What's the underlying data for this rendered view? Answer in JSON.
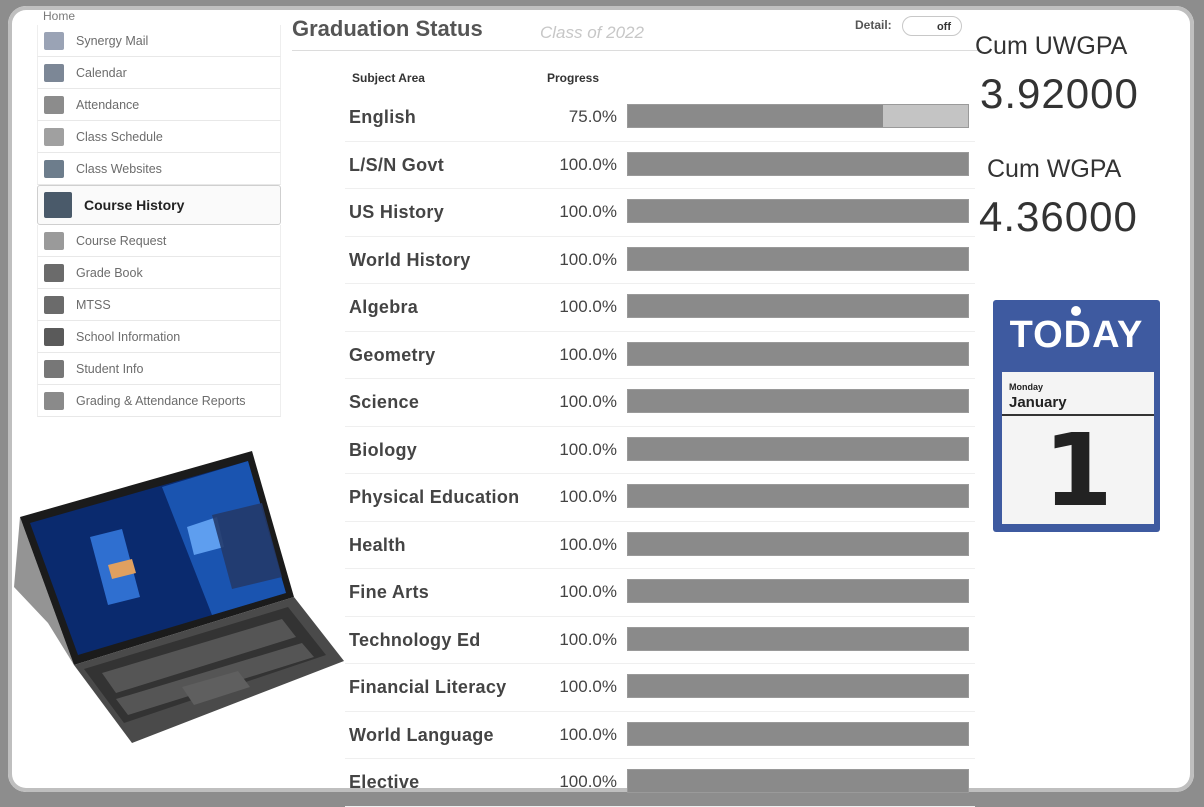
{
  "sidebar": {
    "home": "Home",
    "items": [
      {
        "label": "Synergy Mail",
        "icon": "mail-icon",
        "color": "#9aa3b5"
      },
      {
        "label": "Calendar",
        "icon": "calendar-icon",
        "color": "#7c8796"
      },
      {
        "label": "Attendance",
        "icon": "checkbox-icon",
        "color": "#8c8c8c"
      },
      {
        "label": "Class Schedule",
        "icon": "schedule-icon",
        "color": "#a0a0a0"
      },
      {
        "label": "Class Websites",
        "icon": "websites-icon",
        "color": "#6d7d8c"
      },
      {
        "label": "Course History",
        "icon": "books-icon",
        "color": "#4a5a6a",
        "active": true
      },
      {
        "label": "Course Request",
        "icon": "request-icon",
        "color": "#9a9a9a"
      },
      {
        "label": "Grade Book",
        "icon": "gradebook-icon",
        "color": "#6b6b6b"
      },
      {
        "label": "MTSS",
        "icon": "mtss-icon",
        "color": "#6b6b6b"
      },
      {
        "label": "School Information",
        "icon": "school-icon",
        "color": "#5a5a5a"
      },
      {
        "label": "Student Info",
        "icon": "student-icon",
        "color": "#777777"
      },
      {
        "label": "Grading & Attendance Reports",
        "icon": "reports-icon",
        "color": "#8a8a8a"
      }
    ]
  },
  "header": {
    "title": "Graduation Status",
    "subtitle": "Class of 2022",
    "detail_label": "Detail:",
    "toggle": "off"
  },
  "table": {
    "col_subject": "Subject Area",
    "col_progress": "Progress",
    "rows": [
      {
        "subject": "English",
        "progress": "75.0%",
        "value": 0.75
      },
      {
        "subject": "L/S/N Govt",
        "progress": "100.0%",
        "value": 1
      },
      {
        "subject": "US History",
        "progress": "100.0%",
        "value": 1
      },
      {
        "subject": "World History",
        "progress": "100.0%",
        "value": 1
      },
      {
        "subject": "Algebra",
        "progress": "100.0%",
        "value": 1
      },
      {
        "subject": "Geometry",
        "progress": "100.0%",
        "value": 1
      },
      {
        "subject": "Science",
        "progress": "100.0%",
        "value": 1
      },
      {
        "subject": "Biology",
        "progress": "100.0%",
        "value": 1
      },
      {
        "subject": "Physical Education",
        "progress": "100.0%",
        "value": 1
      },
      {
        "subject": "Health",
        "progress": "100.0%",
        "value": 1
      },
      {
        "subject": "Fine Arts",
        "progress": "100.0%",
        "value": 1
      },
      {
        "subject": "Technology Ed",
        "progress": "100.0%",
        "value": 1
      },
      {
        "subject": "Financial Literacy",
        "progress": "100.0%",
        "value": 1
      },
      {
        "subject": "World Language",
        "progress": "100.0%",
        "value": 1
      },
      {
        "subject": "Elective",
        "progress": "100.0%",
        "value": 1
      }
    ]
  },
  "gpa": {
    "uw_label": "Cum UWGPA",
    "uw_value": "3.92000",
    "w_label": "Cum WGPA",
    "w_value": "4.36000"
  },
  "calendar": {
    "header": "TODAY",
    "weekday": "Monday",
    "month": "January",
    "day": "1"
  }
}
